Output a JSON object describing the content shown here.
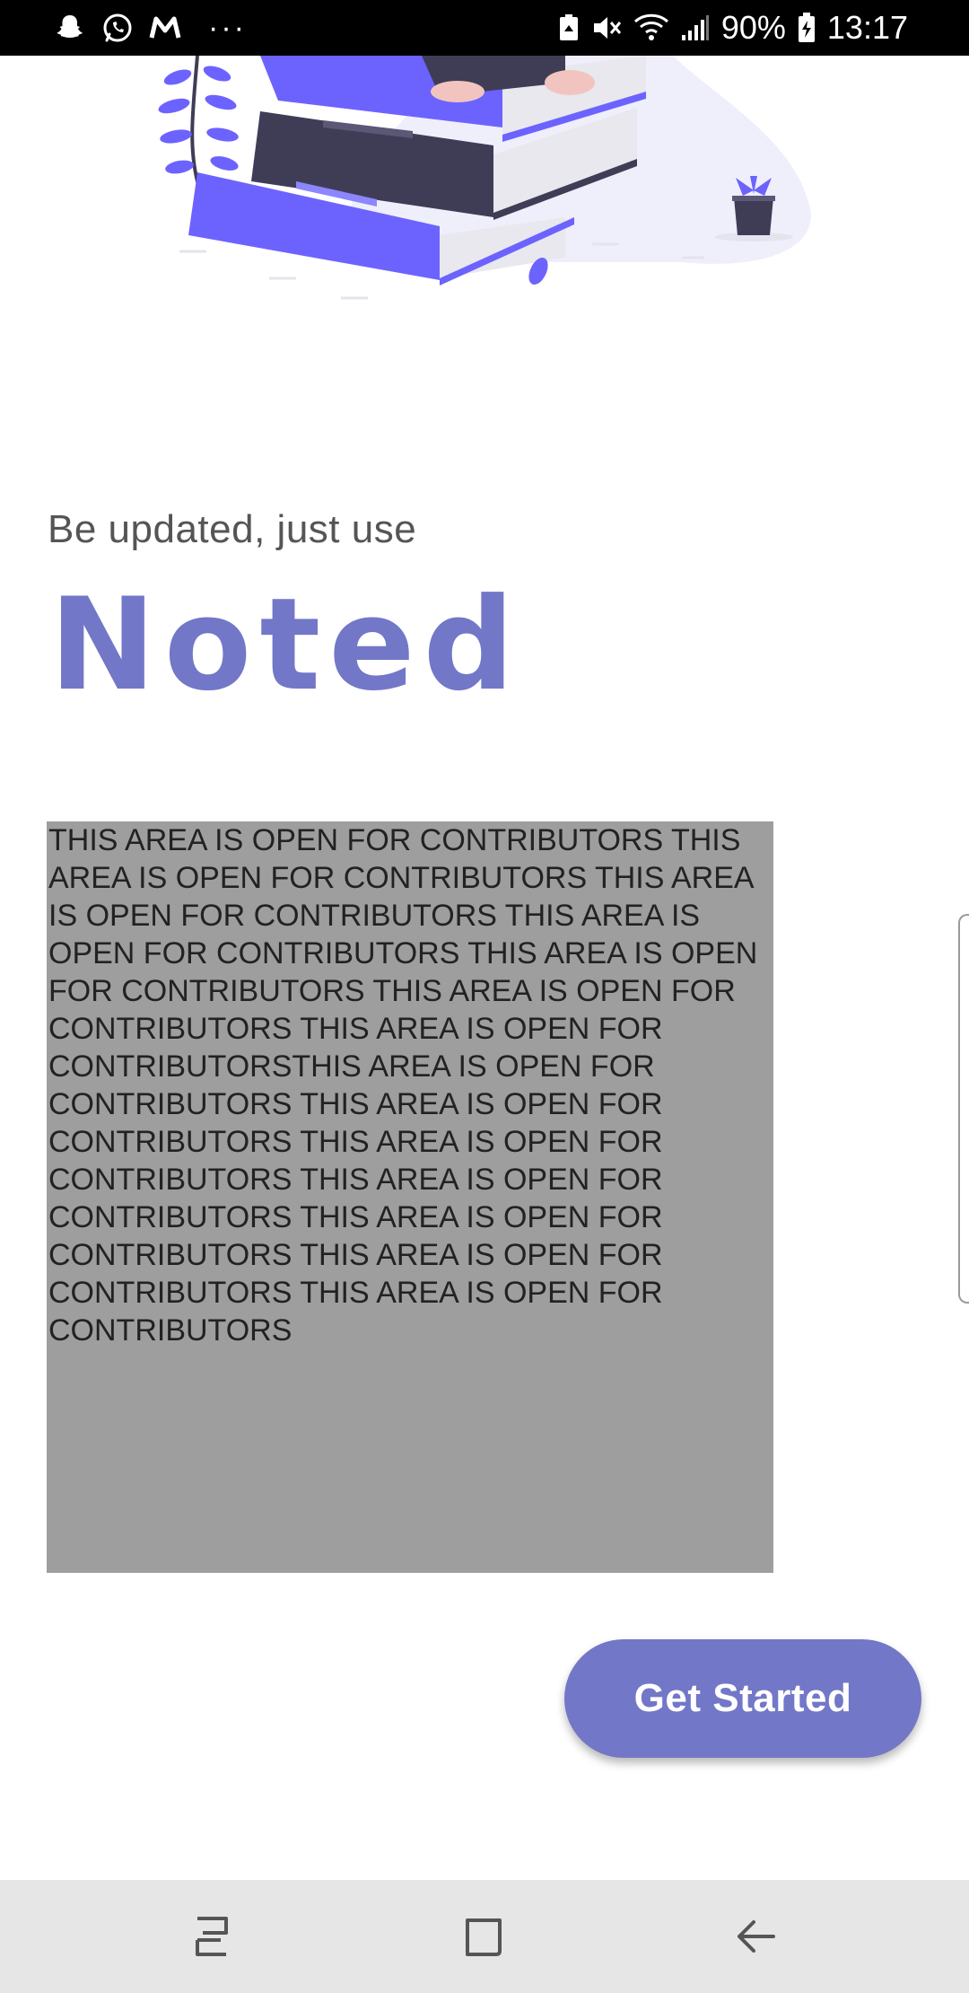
{
  "status_bar": {
    "battery_percent": "90%",
    "time": "13:17",
    "more_indicator": "···",
    "left_icons": [
      "snapchat-icon",
      "whatsapp-icon",
      "gmail-icon"
    ],
    "right_icons": [
      "battery-saver-icon",
      "mute-icon",
      "wifi-icon",
      "signal-icon",
      "charging-battery-icon"
    ]
  },
  "hero": {
    "illustration": "books-stack-illustration",
    "tagline": "Be updated, just use",
    "app_name": "Noted"
  },
  "contributors_area": {
    "text": "THIS AREA IS OPEN FOR CONTRIBUTORS THIS AREA IS OPEN FOR CONTRIBUTORS THIS AREA IS OPEN FOR CONTRIBUTORS THIS AREA IS OPEN FOR CONTRIBUTORS THIS AREA IS OPEN FOR CONTRIBUTORS THIS AREA IS OPEN FOR CONTRIBUTORS THIS AREA IS OPEN FOR CONTRIBUTORSTHIS AREA IS OPEN FOR CONTRIBUTORS THIS AREA IS OPEN FOR CONTRIBUTORS THIS AREA IS OPEN FOR CONTRIBUTORS THIS AREA IS OPEN FOR CONTRIBUTORS THIS AREA IS OPEN FOR CONTRIBUTORS THIS AREA IS OPEN FOR CONTRIBUTORS THIS AREA IS OPEN FOR CONTRIBUTORS",
    "background_color": "#9e9e9e"
  },
  "actions": {
    "get_started_label": "Get Started"
  },
  "colors": {
    "accent": "#7277c7",
    "illustration_purple": "#6c63ff",
    "illustration_dark": "#3f3d56",
    "status_bar": "#000000",
    "nav_bar": "#e6e6e6"
  },
  "nav_bar": {
    "buttons": [
      "recent-apps-icon",
      "home-icon",
      "back-icon"
    ]
  }
}
